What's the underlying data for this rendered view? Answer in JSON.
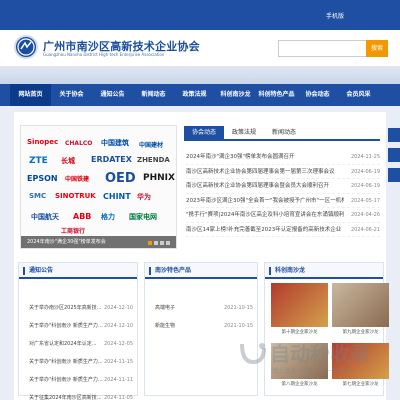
{
  "top": {
    "mobile_label": "手机版"
  },
  "header": {
    "logo_text": "",
    "title": "广州市南沙区高新技术企业协会",
    "subtitle": "Guangzhou Nansha District High-tech Enterprise Association",
    "search_button": "搜索",
    "search_placeholder": ""
  },
  "nav": [
    "网站首页",
    "关于协会",
    "通知公告",
    "新闻动态",
    "政策法规",
    "科创南沙龙",
    "科创特色产品",
    "协会动态",
    "会员风采"
  ],
  "banner": {
    "caption": "2024年南沙\"满企30强\"榜单发布会",
    "words": [
      "Sinopec",
      "CHALCO",
      "中国建筑",
      "中国建材",
      "ZTE",
      "长城",
      "ERDATEX",
      "ZHENDA",
      "EPSON",
      "中国铁建",
      "OED",
      "PHNIX",
      "SMC",
      "SINOTRUK",
      "CHINT",
      "华为",
      "中国航天",
      "ABB",
      "格力",
      "国家电网",
      "工商银行"
    ]
  },
  "tabs": [
    "协会动态",
    "政策法规",
    "新闻动态"
  ],
  "news": [
    {
      "title": "2024年南沙\"满企30强\"榜单发布会圆满召开",
      "date": "2024-11-25"
    },
    {
      "title": "南沙区高新技术企业协会第四届理事会第一届第三次理事会议",
      "date": "2024-06-19"
    },
    {
      "title": "南沙区高新技术企业协会第四届理事会暨会员大会顺利召开",
      "date": "2024-06-19"
    },
    {
      "title": "2023年南沙区满企30强\"全会首一\"我会被授予广州市\"一区一机构\"",
      "date": "2024-05-17"
    },
    {
      "title": "\"携手行\"赛项|2024年南沙区高企及科小培育宣讲会在东涌镇顺利举...",
      "date": "2024-04-26"
    },
    {
      "title": "南沙区14家上榜!补充完善截至2023年认定报备的高新技术企业",
      "date": "2024-06-21"
    }
  ],
  "box1": {
    "title": "通知公告",
    "items": [
      {
        "title": "关于举办南沙区2025年高新技...",
        "date": "2024-12-10"
      },
      {
        "title": "关于举办\"科创南沙 新质生产力...",
        "date": "2024-12-10"
      },
      {
        "title": "对广东省认定和2024年认定...",
        "date": "2024-12-05"
      },
      {
        "title": "关于举办\"科创南沙 新质生产力...",
        "date": "2024-11-15"
      },
      {
        "title": "关于举办\"科创南沙 新质生产力...",
        "date": "2024-11-11"
      },
      {
        "title": "关于征集2024年南沙区高新技...",
        "date": "2024-11-05"
      }
    ]
  },
  "box2": {
    "title": "南沙特色产品",
    "items": [
      {
        "title": "高端电子",
        "date": "2021-10-15"
      },
      {
        "title": "新能生物",
        "date": "2021-10-15"
      }
    ]
  },
  "box3": {
    "title": "科创南沙龙",
    "captions": [
      "第十期企业家沙龙",
      "第九期企业家沙龙",
      "第八期企业家沙龙",
      "第七期企业家沙龙"
    ]
  },
  "watermark": {
    "main": "自动秒收录",
    "sub": "做上排名一来访一次一秒收录"
  },
  "colors": {
    "primary": "#1f4fa3",
    "accent": "#f39800"
  }
}
